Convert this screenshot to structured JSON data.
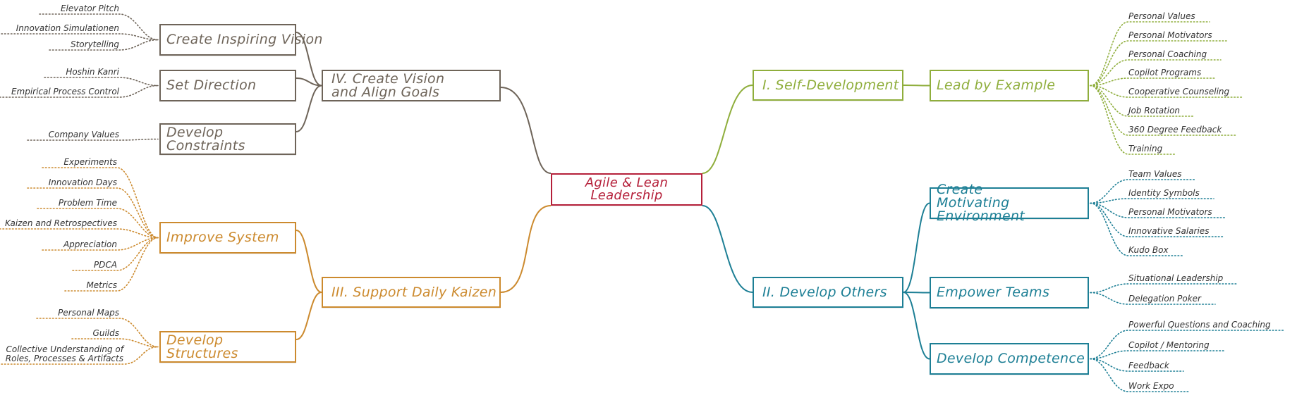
{
  "colors": {
    "root": "#b5203a",
    "vision": "#6e6459",
    "kaizen": "#cc8a2e",
    "self": "#8fae3c",
    "others": "#1d7f95",
    "leaf_text": "#333333"
  },
  "root": {
    "label": "Agile & Lean Leadership"
  },
  "branches": {
    "self_development": {
      "label": "I. Self-Development",
      "children": {
        "lead_by_example": {
          "label": "Lead by Example",
          "leaves": [
            "Personal Values",
            "Personal Motivators",
            "Personal Coaching",
            "Copilot Programs",
            "Cooperative Counseling",
            "Job Rotation",
            "360 Degree Feedback",
            "Training"
          ]
        }
      }
    },
    "develop_others": {
      "label": "II. Develop Others",
      "children": {
        "motivating_env": {
          "label": "Create Motivating Environment",
          "leaves": [
            "Team Values",
            "Identity Symbols",
            "Personal Motivators",
            "Innovative Salaries",
            "Kudo Box"
          ]
        },
        "empower_teams": {
          "label": "Empower Teams",
          "leaves": [
            "Situational Leadership",
            "Delegation Poker"
          ]
        },
        "develop_competence": {
          "label": "Develop Competence",
          "leaves": [
            "Powerful Questions and Coaching",
            "Copilot / Mentoring",
            "Feedback",
            "Work Expo"
          ]
        }
      }
    },
    "support_kaizen": {
      "label": "III. Support Daily Kaizen",
      "children": {
        "improve_system": {
          "label": "Improve System",
          "leaves": [
            "Experiments",
            "Innovation Days",
            "Problem Time",
            "Kaizen and Retrospectives",
            "Appreciation",
            "PDCA",
            "Metrics"
          ]
        },
        "develop_structures": {
          "label": "Develop Structures",
          "leaves": [
            "Personal Maps",
            "Guilds",
            "Collective Understanding of Roles, Processes & Artifacts"
          ]
        }
      }
    },
    "vision_goals": {
      "label": "IV. Create Vision and Align Goals",
      "children": {
        "inspiring_vision": {
          "label": "Create Inspiring Vision",
          "leaves": [
            "Elevator Pitch",
            "Innovation Simulationen",
            "Storytelling"
          ]
        },
        "set_direction": {
          "label": "Set Direction",
          "leaves": [
            "Hoshin Kanri",
            "Empirical Process Control"
          ]
        },
        "develop_constraints": {
          "label": "Develop Constraints",
          "leaves": [
            "Company Values"
          ]
        }
      }
    }
  }
}
